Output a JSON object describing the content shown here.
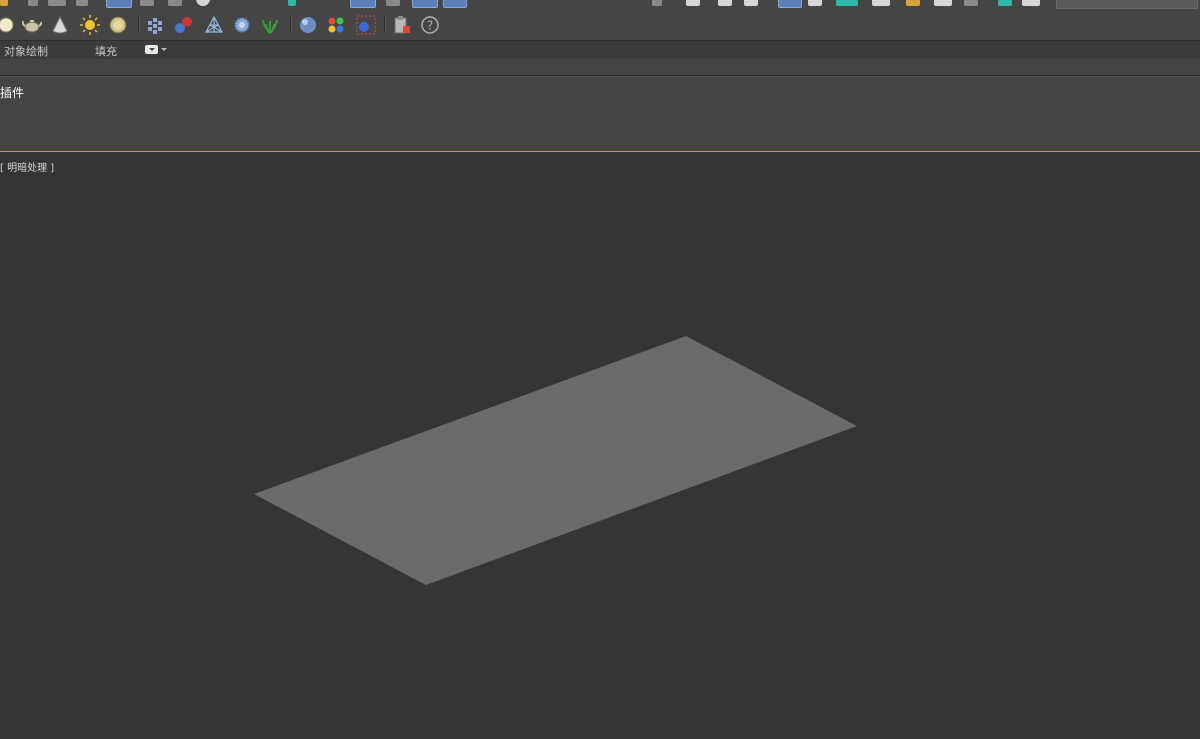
{
  "ribbon": {
    "tabs": [
      "对象绘制",
      "填充"
    ]
  },
  "panel": {
    "title": "插件"
  },
  "viewport": {
    "label": "[ 明暗处理 ]",
    "object": {
      "name": "plane",
      "color": "#6b6b6b"
    }
  },
  "toolbar": {
    "help_glyph": "?"
  },
  "colors": {
    "background": "#353535",
    "toolbar": "#454545",
    "panel": "#444444",
    "active_border": "#c89a3c",
    "accent_blue": "#5b7fb8"
  }
}
